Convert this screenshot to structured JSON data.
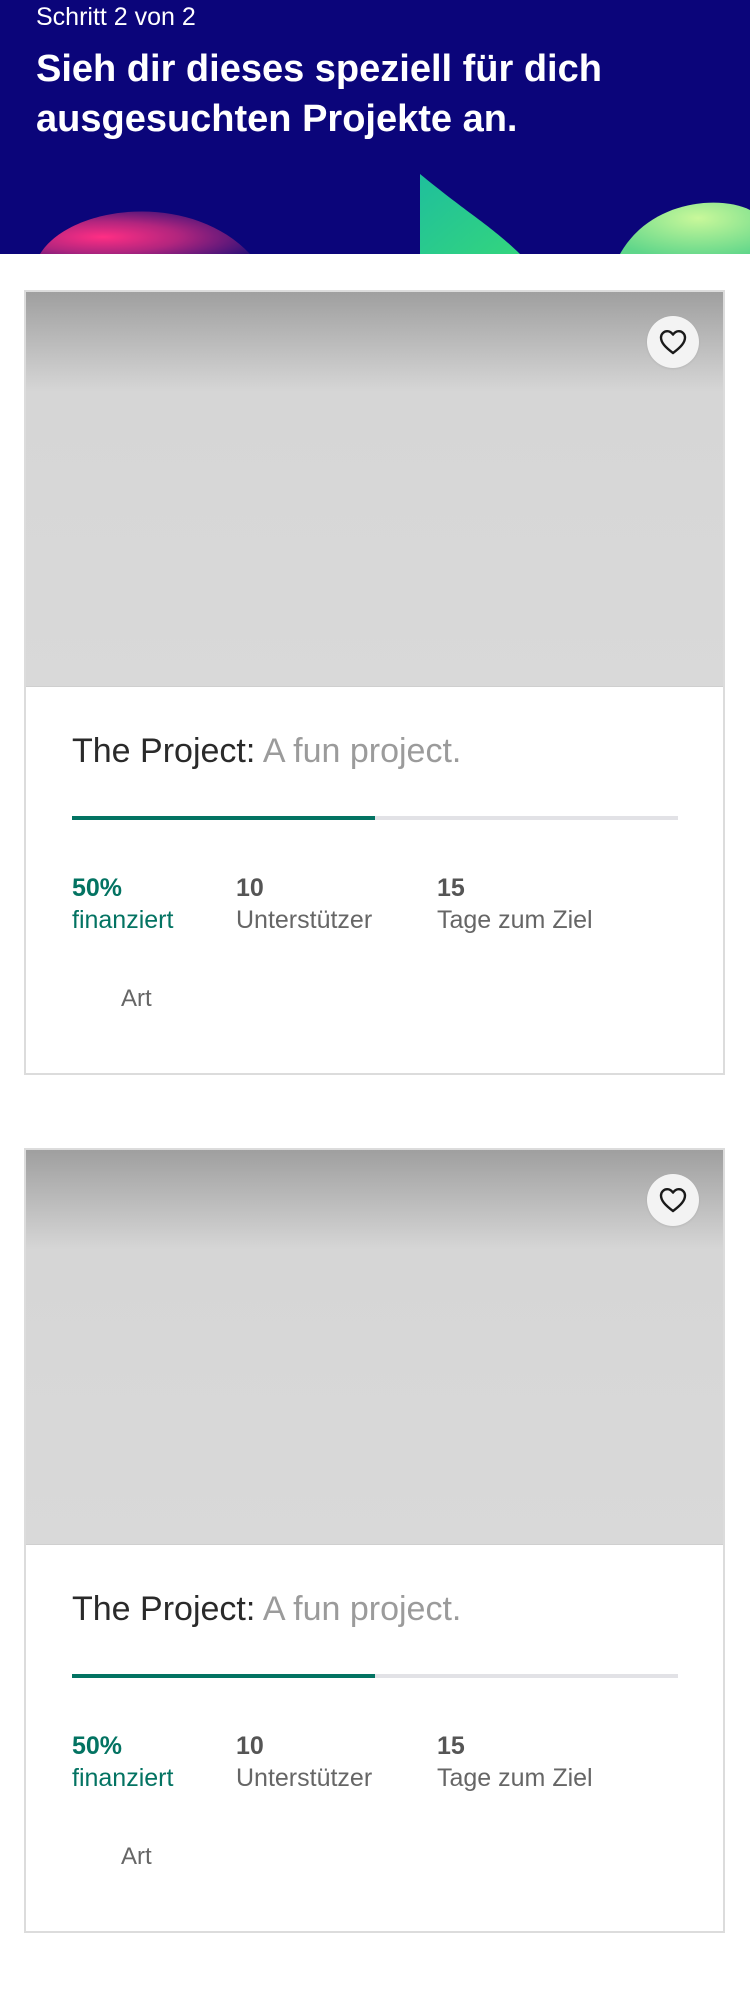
{
  "header": {
    "step": "Schritt 2 von 2",
    "title": "Sieh dir dieses speziell für dich ausgesuchten Projekte an.",
    "colors": {
      "background": "#0b057a",
      "blob_pink": "#ff2e84",
      "blob_green": "#2fd39a",
      "blob_lime": "#b5f08a"
    }
  },
  "projects": [
    {
      "name": "The Project:",
      "blurb": "A fun project.",
      "funded_value": "50%",
      "funded_label": "finanziert",
      "funded_fraction": 0.5,
      "backers_value": "10",
      "backers_label": "Unterstützer",
      "days_value": "15",
      "days_label": "Tage zum Ziel",
      "category": "Art",
      "favorite_icon": "heart-outline-icon"
    },
    {
      "name": "The Project:",
      "blurb": "A fun project.",
      "funded_value": "50%",
      "funded_label": "finanziert",
      "funded_fraction": 0.5,
      "backers_value": "10",
      "backers_label": "Unterstützer",
      "days_value": "15",
      "days_label": "Tage zum Ziel",
      "category": "Art",
      "favorite_icon": "heart-outline-icon"
    }
  ],
  "colors": {
    "accent": "#037362",
    "progress_track": "#e2e2e6",
    "muted_text": "#9b9b9b"
  }
}
